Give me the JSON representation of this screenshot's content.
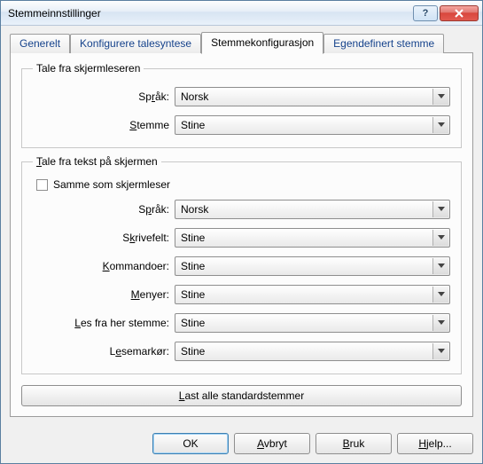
{
  "window": {
    "title": "Stemmeinnstillinger"
  },
  "tabs": {
    "generelt": "Generelt",
    "konfigurere": "Konfigurere talesyntese",
    "stemmekonfig": "Stemmekonfigurasjon",
    "egendefinert": "Egendefinert stemme"
  },
  "group1": {
    "legend": "Tale fra skjermleseren",
    "sprak_label_pre": "Sp",
    "sprak_label_u": "r",
    "sprak_label_post": "åk:",
    "sprak_value": "Norsk",
    "stemme_label_pre": "",
    "stemme_label_u": "S",
    "stemme_label_post": "temme",
    "stemme_value": "Stine"
  },
  "group2": {
    "legend_pre": "",
    "legend_u": "T",
    "legend_post": "ale fra tekst på skjermen",
    "checkbox_label": "Samme som skjermleser",
    "sprak_label_pre": "S",
    "sprak_label_u": "p",
    "sprak_label_post": "råk:",
    "sprak_value": "Norsk",
    "skrivefelt_label_pre": "S",
    "skrivefelt_label_u": "k",
    "skrivefelt_label_post": "rivefelt:",
    "skrivefelt_value": "Stine",
    "kommandoer_label_pre": "",
    "kommandoer_label_u": "K",
    "kommandoer_label_post": "ommandoer:",
    "kommandoer_value": "Stine",
    "menyer_label_pre": "",
    "menyer_label_u": "M",
    "menyer_label_post": "enyer:",
    "menyer_value": "Stine",
    "lesfra_label_pre": "",
    "lesfra_label_u": "L",
    "lesfra_label_post": "es fra her stemme:",
    "lesfra_value": "Stine",
    "lesemarkor_label_pre": "L",
    "lesemarkor_label_u": "e",
    "lesemarkor_label_post": "semarkør:",
    "lesemarkor_value": "Stine"
  },
  "load_btn_pre": "",
  "load_btn_u": "L",
  "load_btn_post": "ast alle standardstemmer",
  "footer": {
    "ok": "OK",
    "avbryt_pre": "",
    "avbryt_u": "A",
    "avbryt_post": "vbryt",
    "bruk_pre": "",
    "bruk_u": "B",
    "bruk_post": "ruk",
    "hjelp_pre": "",
    "hjelp_u": "H",
    "hjelp_post": "jelp..."
  }
}
